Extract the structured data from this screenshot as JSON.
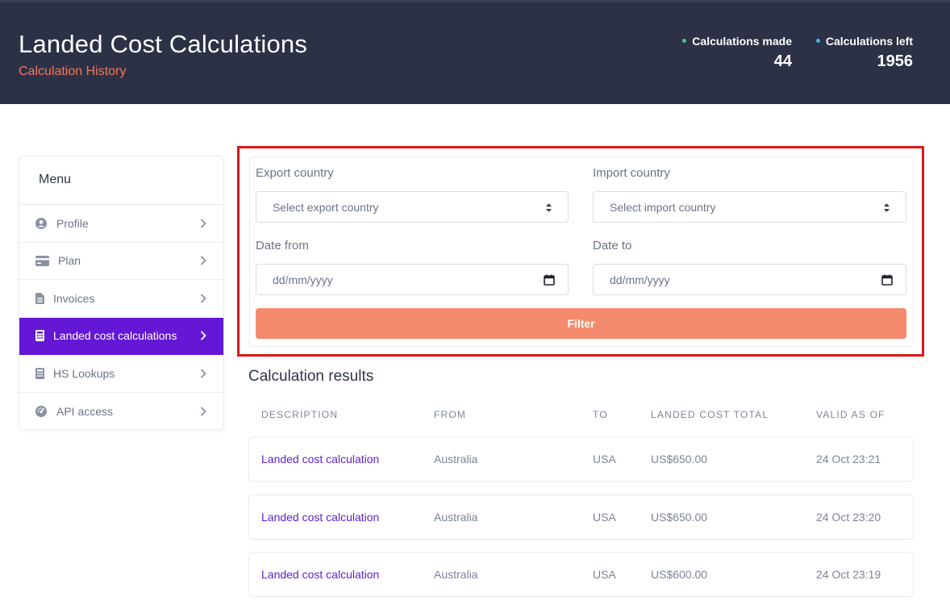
{
  "header": {
    "title": "Landed Cost Calculations",
    "subtitle": "Calculation History",
    "stats": [
      {
        "label": "Calculations made",
        "value": "44",
        "dot_color": "#4cc792"
      },
      {
        "label": "Calculations left",
        "value": "1956",
        "dot_color": "#3fb7e6"
      }
    ]
  },
  "menu": {
    "title": "Menu",
    "items": [
      {
        "label": "Profile",
        "icon": "user-circle-icon",
        "active": false
      },
      {
        "label": "Plan",
        "icon": "credit-card-icon",
        "active": false
      },
      {
        "label": "Invoices",
        "icon": "document-icon",
        "active": false
      },
      {
        "label": "Landed cost calculations",
        "icon": "calculator-icon",
        "active": true
      },
      {
        "label": "HS Lookups",
        "icon": "calculator-icon",
        "active": false
      },
      {
        "label": "API access",
        "icon": "gauge-icon",
        "active": false
      }
    ]
  },
  "filter": {
    "export_label": "Export country",
    "export_placeholder": "Select export country",
    "import_label": "Import country",
    "import_placeholder": "Select import country",
    "date_from_label": "Date from",
    "date_from_placeholder": "dd/mm/yyyy",
    "date_to_label": "Date to",
    "date_to_placeholder": "dd/mm/yyyy",
    "button_label": "Filter"
  },
  "results": {
    "title": "Calculation results",
    "columns": [
      "DESCRIPTION",
      "FROM",
      "TO",
      "LANDED COST TOTAL",
      "VALID AS OF"
    ],
    "rows": [
      {
        "description": "Landed cost calculation",
        "from": "Australia",
        "to": "USA",
        "total": "US$650.00",
        "valid": "24 Oct 23:21"
      },
      {
        "description": "Landed cost calculation",
        "from": "Australia",
        "to": "USA",
        "total": "US$650.00",
        "valid": "24 Oct 23:20"
      },
      {
        "description": "Landed cost calculation",
        "from": "Australia",
        "to": "USA",
        "total": "US$600.00",
        "valid": "24 Oct 23:19"
      }
    ]
  },
  "colors": {
    "header_bg": "#2c3146",
    "accent_orange": "#f4765a",
    "active_purple": "#6418d6",
    "filter_button": "#f38a6c",
    "highlight_border": "#e0161d"
  }
}
